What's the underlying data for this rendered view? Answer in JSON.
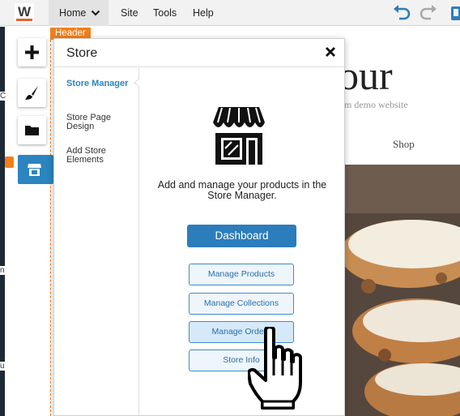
{
  "topbar": {
    "logo_letter": "W",
    "menu": {
      "home": "Home",
      "site": "Site",
      "tools": "Tools",
      "help": "Help"
    },
    "icons": {
      "undo": "undo-icon",
      "redo": "redo-icon",
      "mobile": "mobile-preview-icon",
      "home_chevron": "chevron-down-icon"
    }
  },
  "canvas": {
    "header_tag": "Header",
    "site_title_fragment": "our",
    "site_tagline_fragment": "m demo website",
    "nav_shop": "Shop",
    "left_strip_letters": [
      "C",
      "n",
      "u"
    ]
  },
  "toolbar": {
    "icons": [
      "plus-icon",
      "paintbrush-icon",
      "folder-icon",
      "store-icon"
    ]
  },
  "panel": {
    "title": "Store",
    "nav": {
      "store_manager": "Store Manager",
      "store_page_design": "Store Page Design",
      "add_store_elements": "Add Store Elements"
    },
    "description": "Add and manage your products in the Store Manager.",
    "buttons": {
      "dashboard": "Dashboard",
      "manage_products": "Manage Products",
      "manage_collections": "Manage Collections",
      "manage_orders": "Manage Orders",
      "store_info": "Store Info"
    }
  },
  "colors": {
    "accent_blue": "#2c85bf",
    "header_orange": "#f07f1b",
    "logo_orange": "#e8612c"
  }
}
